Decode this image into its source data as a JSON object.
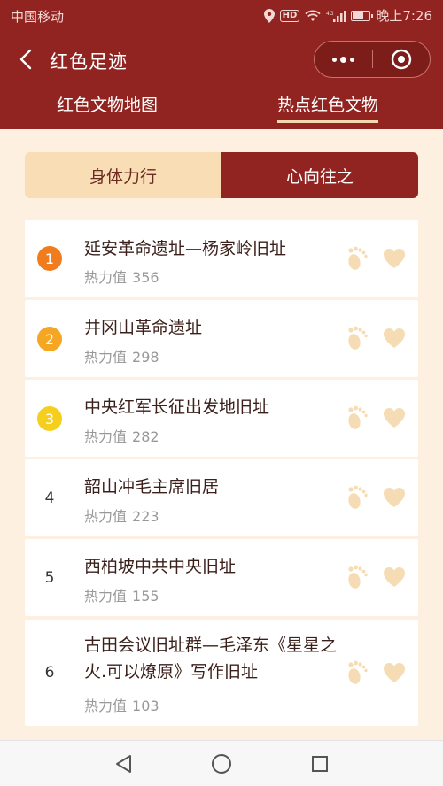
{
  "status_bar": {
    "carrier": "中国移动",
    "time": "晚上7:26",
    "hd": "HD",
    "network": "4G",
    "battery_level": 0.7
  },
  "nav": {
    "title": "红色足迹"
  },
  "tabs": [
    {
      "label": "红色文物地图",
      "active": false
    },
    {
      "label": "热点红色文物",
      "active": true
    }
  ],
  "segment": [
    {
      "label": "身体力行",
      "active": false
    },
    {
      "label": "心向往之",
      "active": true
    }
  ],
  "heat_label": "热力值",
  "items": [
    {
      "rank": "1",
      "title": "延安革命遗址—杨家岭旧址",
      "heat": "356",
      "badge_color": "#f07c1e"
    },
    {
      "rank": "2",
      "title": "井冈山革命遗址",
      "heat": "298",
      "badge_color": "#f5a623"
    },
    {
      "rank": "3",
      "title": "中央红军长征出发地旧址",
      "heat": "282",
      "badge_color": "#f5cf1c"
    },
    {
      "rank": "4",
      "title": "韶山冲毛主席旧居",
      "heat": "223",
      "badge_color": ""
    },
    {
      "rank": "5",
      "title": "西柏坡中共中央旧址",
      "heat": "155",
      "badge_color": ""
    },
    {
      "rank": "6",
      "title": "古田会议旧址群—毛泽东《星星之火.可以燎原》写作旧址",
      "heat": "103",
      "badge_color": ""
    }
  ],
  "colors": {
    "primary": "#912420",
    "accent_light": "#f8ddb5",
    "background": "#fdf0e0",
    "icon_tint": "#f6dcb4"
  },
  "icons": {
    "back": "chevron-left-icon",
    "more": "more-dots-icon",
    "close": "target-circle-icon",
    "footprint": "footprint-icon",
    "heart": "heart-icon"
  }
}
